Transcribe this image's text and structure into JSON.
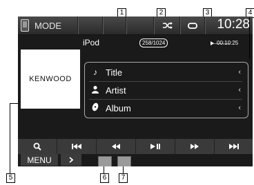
{
  "callouts": {
    "c1": "1",
    "c2": "2",
    "c3": "3",
    "c4": "4",
    "c5": "5",
    "c6": "6",
    "c7": "7"
  },
  "topbar": {
    "mode_label": "MODE",
    "shuffle_icon": "shuffle-icon",
    "repeat_icon": "repeat-icon",
    "clock": "10:28"
  },
  "info": {
    "source": "iPod",
    "track_count": "258/1024",
    "elapsed": "00:10:25"
  },
  "art": {
    "logo_text": "KENWOOD"
  },
  "tags": [
    {
      "icon": "note-icon",
      "label": "Title"
    },
    {
      "icon": "person-icon",
      "label": "Artist"
    },
    {
      "icon": "disc-icon",
      "label": "Album"
    }
  ],
  "controls": {
    "search": "search-icon",
    "prev": "previous-track-icon",
    "rewind": "rewind-icon",
    "play_pause": "play-pause-icon",
    "forward": "fast-forward-icon",
    "next": "next-track-icon"
  },
  "bottom": {
    "menu_label": "MENU"
  }
}
